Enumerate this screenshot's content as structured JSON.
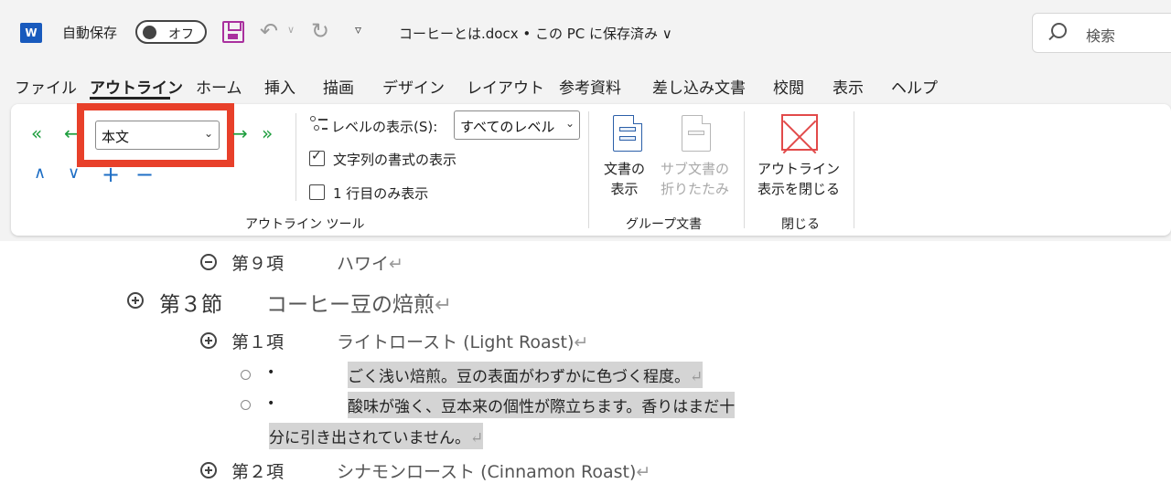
{
  "titlebar": {
    "app_icon": "word-icon",
    "app_icon_text": "W",
    "autosave_label": "自動保存",
    "autosave_state": "オフ",
    "qat_caret": "▿",
    "document_title": "コーヒーとは.docx • この PC に保存済み ∨",
    "search_placeholder": "検索"
  },
  "tabs": [
    "ファイル",
    "アウトライン",
    "ホーム",
    "挿入",
    "描画",
    "デザイン",
    "レイアウト",
    "参考資料",
    "差し込み文書",
    "校閲",
    "表示",
    "ヘルプ"
  ],
  "active_tab": "アウトライン",
  "ribbon": {
    "outline_tools": {
      "promote_to_heading1": "«",
      "promote": "←",
      "level_value": "本文",
      "demote": "→",
      "demote_to_body": "»",
      "move_up": "∧",
      "move_down": "∨",
      "expand": "+",
      "collapse": "−",
      "show_level_label": "レベルの表示(S):",
      "show_level_value": "すべてのレベル",
      "show_text_formatting_label": "文字列の書式の表示",
      "show_text_formatting_checked": true,
      "show_first_line_only_label": "1 行目のみ表示",
      "show_first_line_only_checked": false,
      "group_label": "アウトライン ツール"
    },
    "master_document": {
      "show_document_label_line1": "文書の",
      "show_document_label_line2": "表示",
      "collapse_subdocs_label_line1": "サブ文書の",
      "collapse_subdocs_label_line2": "折りたたみ",
      "group_label": "グループ文書"
    },
    "close": {
      "close_outline_label_line1": "アウトライン",
      "close_outline_label_line2": "表示を閉じる",
      "group_label": "閉じる"
    }
  },
  "highlight_color": "#e8402a",
  "document": {
    "pilcrow": "↵",
    "bullet": "•",
    "items": [
      {
        "num": "第９項",
        "text": "ハワイ"
      },
      {
        "num": "第３節",
        "text": "コーヒー豆の焙煎"
      },
      {
        "num": "第１項",
        "text": "ライトロースト (Light Roast)"
      },
      {
        "body": "ごく浅い焙煎。豆の表面がわずかに色づく程度。"
      },
      {
        "body_line1": "酸味が強く、豆本来の個性が際立ちます。香りはまだ十",
        "body_line2": "分に引き出されていません。"
      },
      {
        "num": "第２項",
        "text": "シナモンロースト (Cinnamon Roast)"
      }
    ]
  }
}
